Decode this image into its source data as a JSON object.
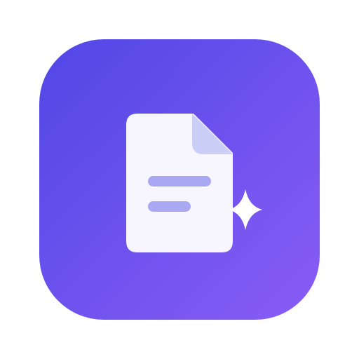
{
  "app_icon": {
    "icon": "document-sparkle-icon",
    "colors": {
      "gradient_start": "#5047E6",
      "gradient_end": "#8A5CF5",
      "page": "#F7F5FD",
      "page_fold": "#CBCEF6",
      "text_lines": "#A9A8F3",
      "sparkle": "#FFFFFF"
    }
  }
}
